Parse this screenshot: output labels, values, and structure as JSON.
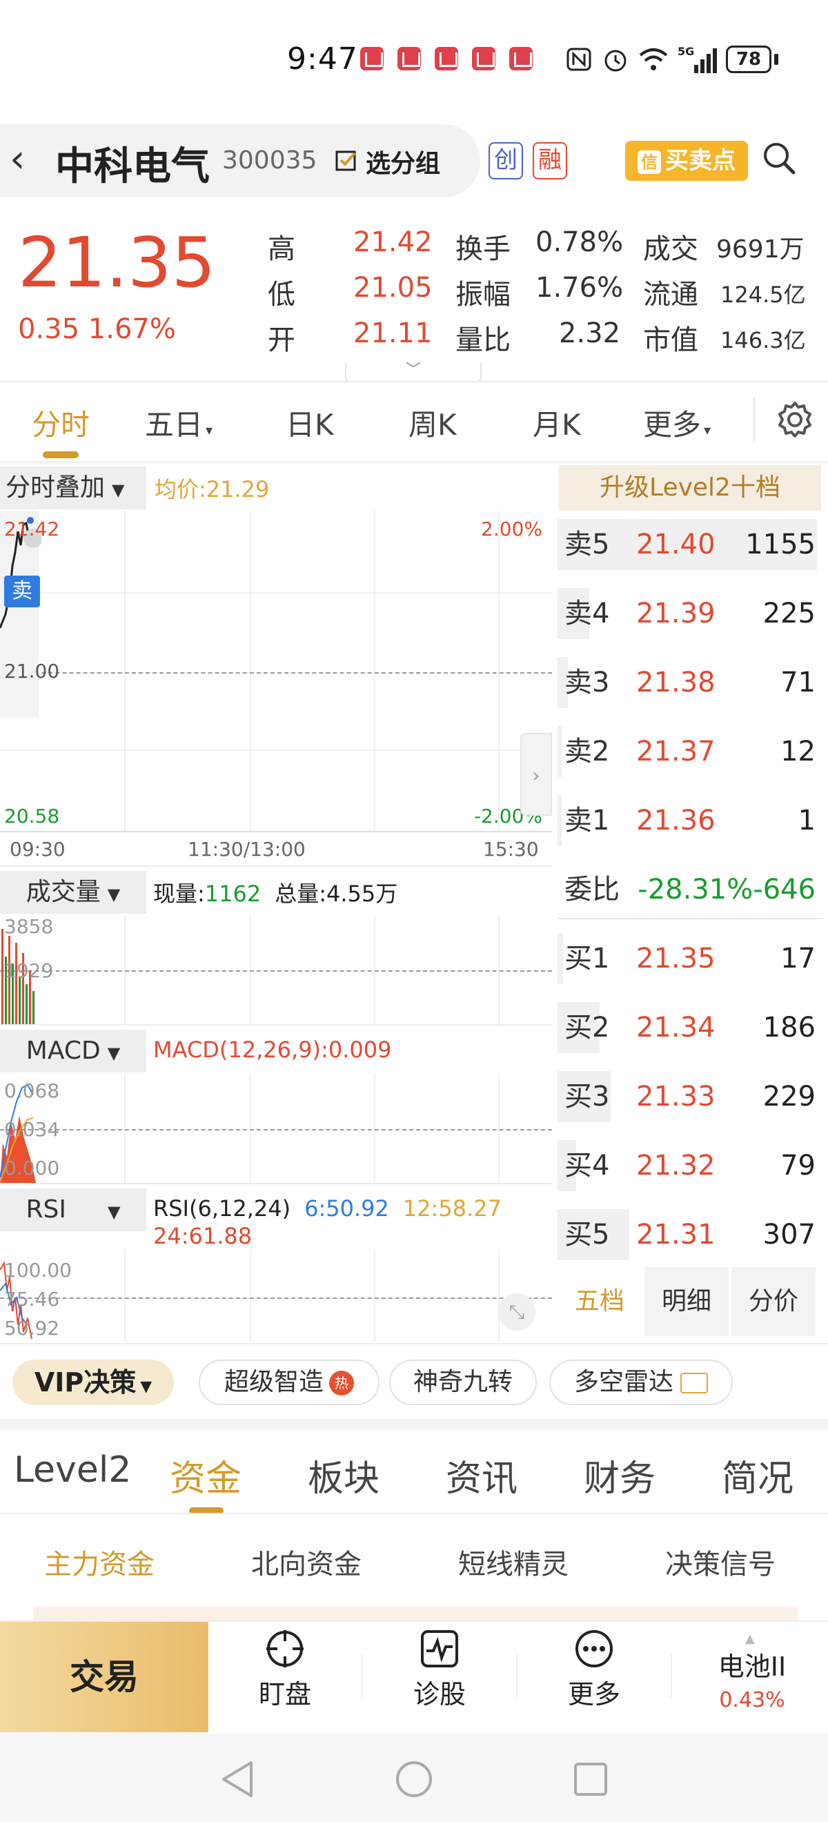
{
  "status_bar": {
    "time": "9:47",
    "battery": "78"
  },
  "header": {
    "stock_name": "中科电气",
    "stock_code": "300035",
    "group_label": "选分组",
    "tag_chuang": "创",
    "tag_rong": "融",
    "buy_sell_label": "买卖点"
  },
  "quote": {
    "price": "21.35",
    "change": "0.35 1.67%",
    "rows": [
      {
        "l1": "高",
        "v1": "21.42",
        "l2": "换手",
        "v2": "0.78%",
        "l3": "成交",
        "v3": "9691万"
      },
      {
        "l1": "低",
        "v1": "21.05",
        "l2": "振幅",
        "v2": "1.76%",
        "l3": "流通",
        "v3": "124.5亿"
      },
      {
        "l1": "开",
        "v1": "21.11",
        "l2": "量比",
        "v2": "2.32",
        "l3": "市值",
        "v3": "146.3亿"
      }
    ]
  },
  "chart_tabs": [
    "分时",
    "五日",
    "日K",
    "周K",
    "月K",
    "更多"
  ],
  "intraday": {
    "overlay_label": "分时叠加",
    "avg_price": "均价:21.29",
    "high_label": "21.42",
    "mid_label": "21.00",
    "low_label": "20.58",
    "pct_high": "2.00%",
    "pct_low": "-2.00%",
    "sell_marker": "卖",
    "time_start": "09:30",
    "time_mid": "11:30/13:00",
    "time_end": "15:30"
  },
  "volume": {
    "label": "成交量",
    "now_key": "现量:",
    "now_val": "1162",
    "total": "总量:4.55万",
    "y_top": "3858",
    "y_mid": "1929"
  },
  "macd": {
    "label": "MACD",
    "value": "MACD(12,26,9):0.009",
    "y1": "0.068",
    "y2": "0.034",
    "y3": "0.000"
  },
  "rsi": {
    "label": "RSI",
    "title": "RSI(6,12,24)",
    "r6": "6:50.92",
    "r12": "12:58.27",
    "r24": "24:61.88",
    "y1": "100.00",
    "y2": "75.46",
    "y3": "50.92"
  },
  "order_book": {
    "header": "升级Level2十档",
    "sells": [
      {
        "label": "卖5",
        "price": "21.40",
        "vol": "1155"
      },
      {
        "label": "卖4",
        "price": "21.39",
        "vol": "225"
      },
      {
        "label": "卖3",
        "price": "21.38",
        "vol": "71"
      },
      {
        "label": "卖2",
        "price": "21.37",
        "vol": "12"
      },
      {
        "label": "卖1",
        "price": "21.36",
        "vol": "1"
      }
    ],
    "ratio_label": "委比",
    "ratio_value": "-28.31%-646",
    "buys": [
      {
        "label": "买1",
        "price": "21.35",
        "vol": "17"
      },
      {
        "label": "买2",
        "price": "21.34",
        "vol": "186"
      },
      {
        "label": "买3",
        "price": "21.33",
        "vol": "229"
      },
      {
        "label": "买4",
        "price": "21.32",
        "vol": "79"
      },
      {
        "label": "买5",
        "price": "21.31",
        "vol": "307"
      }
    ],
    "subtabs": [
      "五档",
      "明细",
      "分价"
    ]
  },
  "vip_bar": {
    "vip": "VIP决策",
    "chips": [
      "超级智造",
      "神奇九转",
      "多空雷达"
    ],
    "hot_badge": "热"
  },
  "bottom_tabs": [
    "Level2",
    "资金",
    "板块",
    "资讯",
    "财务",
    "简况"
  ],
  "sub_tabs": [
    "主力资金",
    "北向资金",
    "短线精灵",
    "决策信号"
  ],
  "action_bar": {
    "trade": "交易",
    "watch": "盯盘",
    "diagnose": "诊股",
    "more": "更多",
    "sector_name": "电池II",
    "sector_change": "0.43%"
  },
  "colors": {
    "up": "#e24a30",
    "down": "#1a9b2e",
    "accent": "#d49a2b"
  }
}
